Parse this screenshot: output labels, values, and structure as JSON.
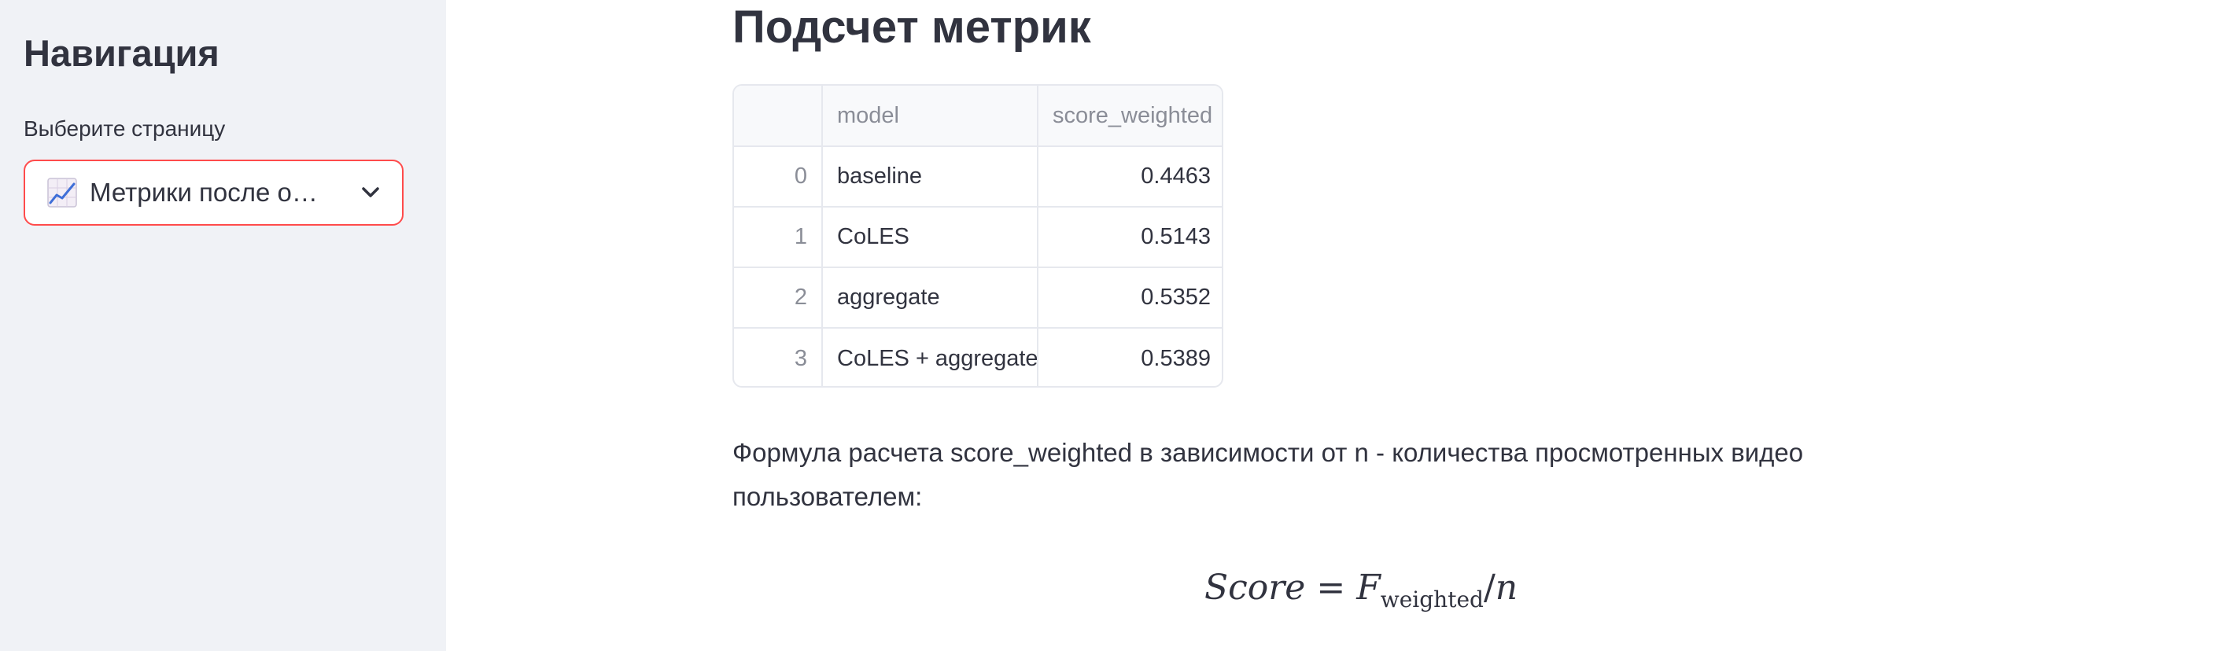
{
  "sidebar": {
    "title": "Навигация",
    "select_label": "Выберите страницу",
    "select_value": "Метрики после о…",
    "select_icon": "chart-increasing-icon"
  },
  "main": {
    "title": "Подсчет метрик",
    "table": {
      "columns": [
        "",
        "model",
        "score_weighted"
      ],
      "rows": [
        {
          "index": "0",
          "model": "baseline",
          "score": "0.4463"
        },
        {
          "index": "1",
          "model": "CoLES",
          "score": "0.5143"
        },
        {
          "index": "2",
          "model": "aggregate",
          "score": "0.5352"
        },
        {
          "index": "3",
          "model": "CoLES + aggregate",
          "score": "0.5389"
        }
      ]
    },
    "formula_description": "Формула расчета score_weighted в зависимости от n - количества просмотренных видео пользователем:",
    "formula": {
      "lhs": "Score",
      "equals": "=",
      "f": "F",
      "subscript": "weighted",
      "slash": "/",
      "n": "n"
    }
  },
  "colors": {
    "sidebar_bg": "#f0f2f6",
    "accent": "#ff4b4b",
    "text": "#31333f",
    "muted": "#8a8d97"
  }
}
